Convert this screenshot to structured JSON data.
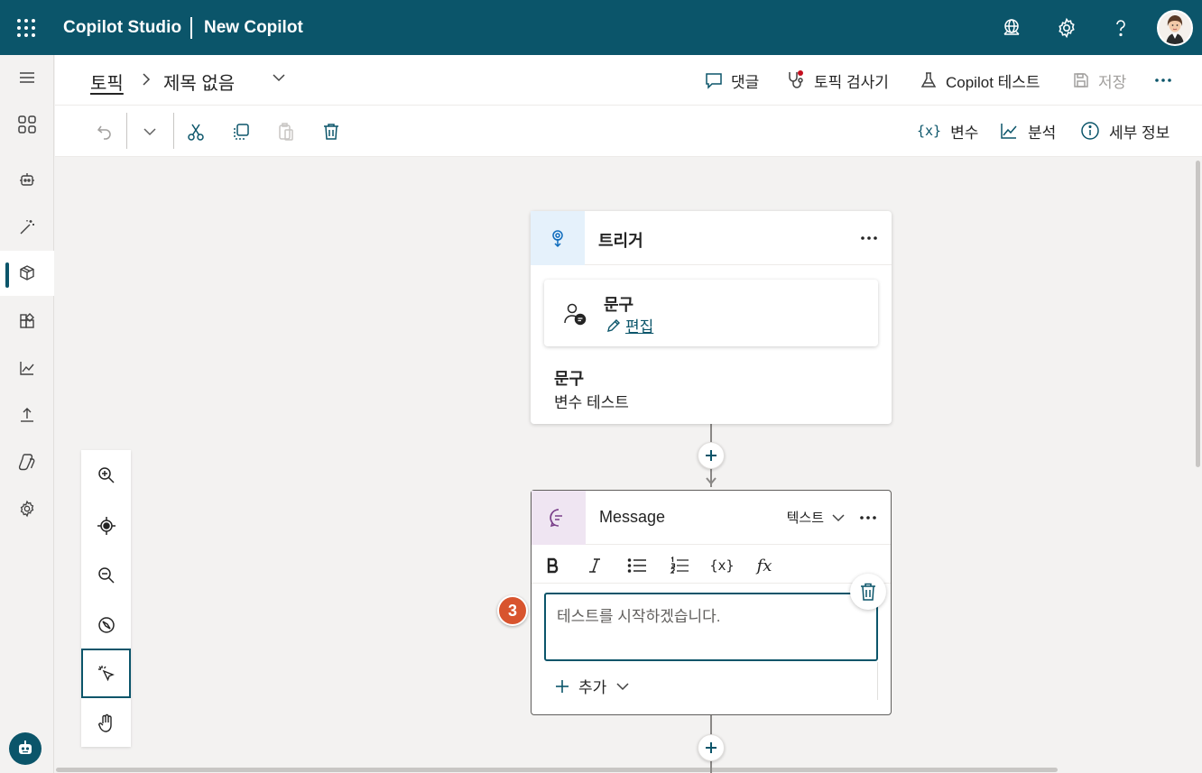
{
  "app": {
    "brand": "Copilot Studio",
    "copilot_name": "New Copilot"
  },
  "breadcrumb": {
    "root": "토픽",
    "title": "제목 없음"
  },
  "header_actions": {
    "comments": "댓글",
    "topic_checker": "토픽 검사기",
    "test": "Copilot 테스트",
    "save": "저장"
  },
  "toolbar_right": {
    "variables": "변수",
    "analytics": "분석",
    "details": "세부 정보"
  },
  "trigger_card": {
    "title": "트리거",
    "phrase_title": "문구",
    "edit_label": "편집",
    "summary_title": "문구",
    "summary_value": "변수 테스트"
  },
  "message_card": {
    "title": "Message",
    "type_label": "텍스트",
    "message_text": "테스트를 시작하겠습니다.",
    "add_label": "추가"
  },
  "step_badge": "3",
  "colors": {
    "brand": "#0b556a",
    "badge": "#d8542e",
    "message_accent": "#efe5f2"
  }
}
